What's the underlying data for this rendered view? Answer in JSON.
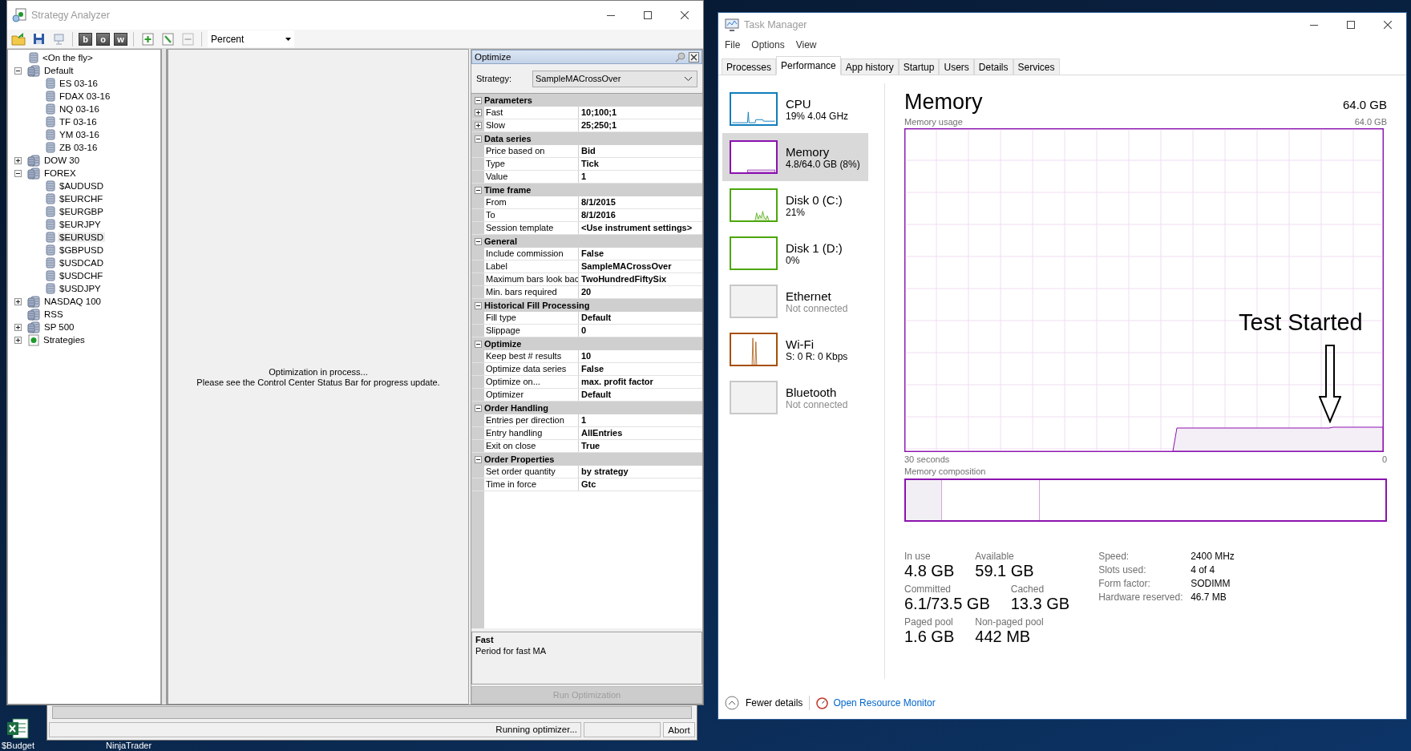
{
  "strategy_analyzer": {
    "title": "Strategy Analyzer",
    "toolbar": {
      "letter_buttons": [
        "b",
        "o",
        "w"
      ],
      "period_type": "Percent"
    },
    "tree": [
      {
        "label": "<On the fly>",
        "kind": "instrument",
        "selected": false
      },
      {
        "label": "Default",
        "kind": "list",
        "expanded": true,
        "selected": false,
        "children": [
          {
            "label": "ES 03-16",
            "kind": "instrument",
            "selected": false
          },
          {
            "label": "FDAX 03-16",
            "kind": "instrument",
            "selected": false
          },
          {
            "label": "NQ 03-16",
            "kind": "instrument",
            "selected": false
          },
          {
            "label": "TF 03-16",
            "kind": "instrument",
            "selected": false
          },
          {
            "label": "YM 03-16",
            "kind": "instrument",
            "selected": false
          },
          {
            "label": "ZB 03-16",
            "kind": "instrument",
            "selected": false
          }
        ]
      },
      {
        "label": "DOW 30",
        "kind": "list",
        "expanded": false,
        "selected": false
      },
      {
        "label": "FOREX",
        "kind": "list",
        "expanded": true,
        "selected": false,
        "children": [
          {
            "label": "$AUDUSD",
            "kind": "instrument",
            "selected": false
          },
          {
            "label": "$EURCHF",
            "kind": "instrument",
            "selected": false
          },
          {
            "label": "$EURGBP",
            "kind": "instrument",
            "selected": false
          },
          {
            "label": "$EURJPY",
            "kind": "instrument",
            "selected": false
          },
          {
            "label": "$EURUSD",
            "kind": "instrument",
            "selected": true
          },
          {
            "label": "$GBPUSD",
            "kind": "instrument",
            "selected": false
          },
          {
            "label": "$USDCAD",
            "kind": "instrument",
            "selected": false
          },
          {
            "label": "$USDCHF",
            "kind": "instrument",
            "selected": false
          },
          {
            "label": "$USDJPY",
            "kind": "instrument",
            "selected": false
          }
        ]
      },
      {
        "label": "NASDAQ 100",
        "kind": "list",
        "expanded": false,
        "selected": false
      },
      {
        "label": "RSS",
        "kind": "list",
        "selected": false
      },
      {
        "label": "SP 500",
        "kind": "list",
        "expanded": false,
        "selected": false
      },
      {
        "label": "Strategies",
        "kind": "strategies",
        "expanded": false,
        "selected": false
      }
    ],
    "status_lines": [
      "Optimization in process...",
      "Please see the Control Center Status Bar for progress update."
    ],
    "optimize_panel": {
      "title": "Optimize",
      "strategy_label": "Strategy:",
      "strategy_value": "SampleMACrossOver",
      "groups": [
        {
          "name": "Parameters",
          "expanded": true,
          "rows": [
            {
              "name": "Fast",
              "value": "10;100;1",
              "kind": "expandable"
            },
            {
              "name": "Slow",
              "value": "25;250;1",
              "kind": "expandable"
            }
          ]
        },
        {
          "name": "Data series",
          "expanded": true,
          "rows": [
            {
              "name": "Price based on",
              "value": "Bid",
              "kind": "plain"
            },
            {
              "name": "Type",
              "value": "Tick",
              "kind": "plain"
            },
            {
              "name": "Value",
              "value": "1",
              "kind": "plain"
            }
          ]
        },
        {
          "name": "Time frame",
          "expanded": true,
          "rows": [
            {
              "name": "From",
              "value": "8/1/2015",
              "kind": "plain"
            },
            {
              "name": "To",
              "value": "8/1/2016",
              "kind": "plain"
            },
            {
              "name": "Session template",
              "value": "<Use instrument settings>",
              "kind": "plain"
            }
          ]
        },
        {
          "name": "General",
          "expanded": true,
          "rows": [
            {
              "name": "Include commission",
              "value": "False",
              "kind": "plain"
            },
            {
              "name": "Label",
              "value": "SampleMACrossOver",
              "kind": "plain"
            },
            {
              "name": "Maximum bars look bac",
              "value": "TwoHundredFiftySix",
              "kind": "plain"
            },
            {
              "name": "Min. bars required",
              "value": "20",
              "kind": "plain"
            }
          ]
        },
        {
          "name": "Historical Fill Processing",
          "expanded": true,
          "rows": [
            {
              "name": "Fill type",
              "value": "Default",
              "kind": "plain"
            },
            {
              "name": "Slippage",
              "value": "0",
              "kind": "plain"
            }
          ]
        },
        {
          "name": "Optimize",
          "expanded": true,
          "rows": [
            {
              "name": "Keep best # results",
              "value": "10",
              "kind": "plain"
            },
            {
              "name": "Optimize data series",
              "value": "False",
              "kind": "plain"
            },
            {
              "name": "Optimize on...",
              "value": "max. profit factor",
              "kind": "plain"
            },
            {
              "name": "Optimizer",
              "value": "Default",
              "kind": "plain"
            }
          ]
        },
        {
          "name": "Order Handling",
          "expanded": true,
          "rows": [
            {
              "name": "Entries per direction",
              "value": "1",
              "kind": "plain"
            },
            {
              "name": "Entry handling",
              "value": "AllEntries",
              "kind": "plain"
            },
            {
              "name": "Exit on close",
              "value": "True",
              "kind": "plain"
            }
          ]
        },
        {
          "name": "Order Properties",
          "expanded": true,
          "rows": [
            {
              "name": "Set order quantity",
              "value": "by strategy",
              "kind": "plain"
            },
            {
              "name": "Time in force",
              "value": "Gtc",
              "kind": "plain"
            }
          ]
        }
      ],
      "description": {
        "title": "Fast",
        "text": "Period for fast MA"
      },
      "run_button": {
        "label": "Run Optimization",
        "disabled": true
      }
    }
  },
  "control_center_status": {
    "message": "Running optimizer...",
    "abort": "Abort"
  },
  "desktop_icons": [
    {
      "label": "$Budget",
      "kind": "spreadsheet"
    },
    {
      "label": "NinjaTrader",
      "kind": "hidden"
    }
  ],
  "task_manager": {
    "title": "Task Manager",
    "menu": [
      "File",
      "Options",
      "View"
    ],
    "tabs": [
      {
        "label": "Processes",
        "selected": false
      },
      {
        "label": "Performance",
        "selected": true
      },
      {
        "label": "App history",
        "selected": false
      },
      {
        "label": "Startup",
        "selected": false
      },
      {
        "label": "Users",
        "selected": false
      },
      {
        "label": "Details",
        "selected": false
      },
      {
        "label": "Services",
        "selected": false
      }
    ],
    "resources": [
      {
        "name": "CPU",
        "detail": "19%  4.04 GHz",
        "kind": "cpu",
        "color": "#117dbb",
        "selected": false,
        "connected": true
      },
      {
        "name": "Memory",
        "detail": "4.8/64.0 GB (8%)",
        "kind": "memory",
        "color": "#8b12ae",
        "selected": true,
        "connected": true
      },
      {
        "name": "Disk 0 (C:)",
        "detail": "21%",
        "kind": "disk",
        "color": "#4da60c",
        "selected": false,
        "connected": true
      },
      {
        "name": "Disk 1 (D:)",
        "detail": "0%",
        "kind": "flat",
        "color": "#4da60c",
        "selected": false,
        "connected": true
      },
      {
        "name": "Ethernet",
        "detail": "Not connected",
        "kind": "none",
        "color": "#c8c8c8",
        "selected": false,
        "connected": false
      },
      {
        "name": "Wi-Fi",
        "detail": "S: 0 R: 0 Kbps",
        "kind": "wifi",
        "color": "#a74f01",
        "selected": false,
        "connected": true
      },
      {
        "name": "Bluetooth",
        "detail": "Not connected",
        "kind": "none",
        "color": "#c8c8c8",
        "selected": false,
        "connected": false
      }
    ],
    "heading": "Memory",
    "total": "64.0 GB",
    "usage_label": "Memory usage",
    "usage_max": "64.0 GB",
    "time_span": "30 seconds",
    "time_end": "0",
    "composition_label": "Memory composition",
    "stat_rows": [
      {
        "items": [
          {
            "label": "In use",
            "value": "4.8 GB"
          },
          {
            "label": "Available",
            "value": "59.1 GB"
          }
        ]
      },
      {
        "items": [
          {
            "label": "Committed",
            "value": "6.1/73.5 GB"
          },
          {
            "label": "Cached",
            "value": "13.3 GB"
          }
        ]
      },
      {
        "items": [
          {
            "label": "Paged pool",
            "value": "1.6 GB"
          },
          {
            "label": "Non-paged pool",
            "value": "442 MB"
          }
        ]
      }
    ],
    "specs": [
      {
        "label": "Speed:",
        "value": "2400 MHz"
      },
      {
        "label": "Slots used:",
        "value": "4 of 4"
      },
      {
        "label": "Form factor:",
        "value": "SODIMM"
      },
      {
        "label": "Hardware reserved:",
        "value": "46.7 MB"
      }
    ],
    "fewer_details": "Fewer details",
    "resource_monitor": "Open Resource Monitor"
  },
  "annotation": {
    "text": "Test Started"
  }
}
